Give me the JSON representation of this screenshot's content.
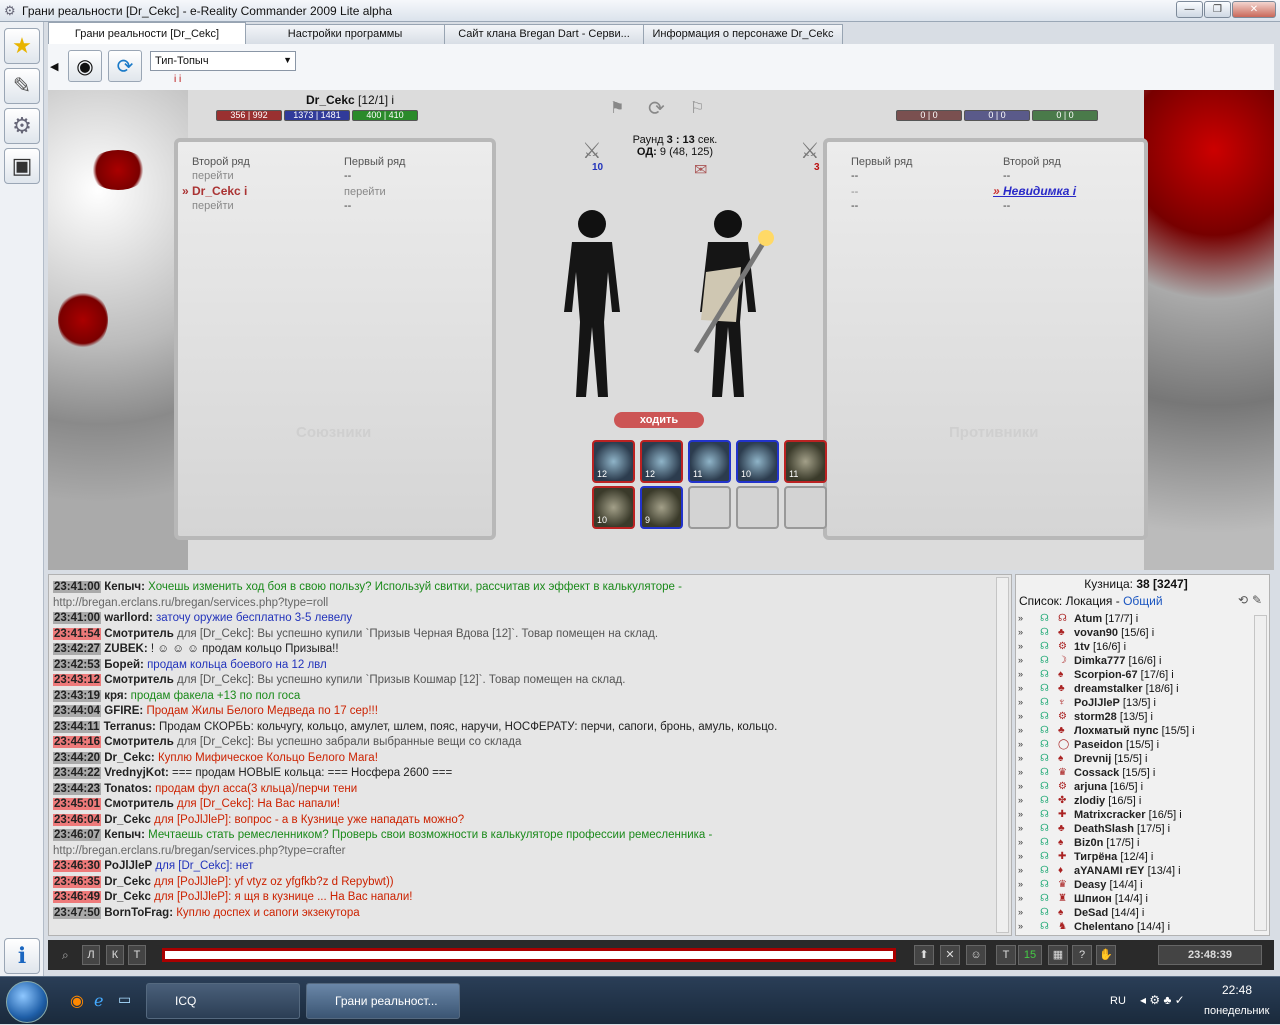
{
  "window": {
    "title": "Грани реальности [Dr_Cekc] - e-Reality Commander 2009 Lite alpha"
  },
  "tabs": [
    {
      "label": "Грани реальности [Dr_Cekc]"
    },
    {
      "label": "Настройки программы"
    },
    {
      "label": "Сайт клана Bregan Dart - Серви..."
    },
    {
      "label": "Информация о персонаже Dr_Cekc"
    }
  ],
  "toolbar": {
    "select_value": "Тип-Топыч",
    "info_marks": "i  i"
  },
  "battle": {
    "player_name": "Dr_Cekc",
    "player_level": "[12/1]",
    "info_mark": "i",
    "hp": "356 | 992",
    "mana": "1373 | 1481",
    "stamina": "400 | 410",
    "enemy_hp": "0 | 0",
    "enemy_mana": "0 | 0",
    "enemy_stamina": "0 | 0",
    "round_label": "Раунд",
    "round_value": "3 : 13",
    "round_unit": "сек.",
    "od_label": "ОД:",
    "od_value": "9 (48, 125)",
    "ally_count": "10",
    "enemy_count": "3",
    "go_button": "ходить",
    "left_panel": {
      "col1": "Второй ряд",
      "col2": "Первый ряд",
      "r1c1": "перейти",
      "r1c2": "--",
      "r2c1": "Dr_Cekc",
      "r2c2": "перейти",
      "r3c1": "перейти",
      "r3c2": "--",
      "footer": "Союзники"
    },
    "right_panel": {
      "col1": "Первый ряд",
      "col2": "Второй ряд",
      "r1c1": "--",
      "r1c2": "--",
      "r2c1": "--",
      "r2c2": "Невидимка",
      "r3c1": "--",
      "r3c2": "--",
      "footer": "Противники"
    },
    "slots": [
      "12",
      "12",
      "11",
      "10",
      "11",
      "10",
      "9"
    ]
  },
  "chat": [
    {
      "time": "23:41:00",
      "nick": "Кепыч:",
      "text": "Хочешь изменить ход боя в свою пользу? Используй свитки, рассчитав их эффект в калькуляторе -",
      "color": "#1a8a1a",
      "hl": false
    },
    {
      "time": "",
      "nick": "",
      "text": "http://bregan.erclans.ru/bregan/services.php?type=roll",
      "color": "#666",
      "hl": false
    },
    {
      "time": "23:41:00",
      "nick": "warllord:",
      "text": "заточу оружие бесплатно 3-5 левелу",
      "color": "#2233bb",
      "hl": false
    },
    {
      "time": "23:41:54",
      "nick": "Смотритель",
      "text": "для [Dr_Cekc]: Вы успешно купили `Призыв Черная Вдова [12]`. Товар помещен на склад.",
      "color": "#555",
      "hl": true
    },
    {
      "time": "23:42:27",
      "nick": "ZUBEK:",
      "text": "!  ☺ ☺ ☺  продам кольцо Призыва!!",
      "color": "#222",
      "hl": false
    },
    {
      "time": "23:42:53",
      "nick": "Борей:",
      "text": "продам кольца боевого на 12 лвл",
      "color": "#2233bb",
      "hl": false
    },
    {
      "time": "23:43:12",
      "nick": "Смотритель",
      "text": "для [Dr_Cekc]: Вы успешно купили `Призыв Кошмар [12]`. Товар помещен на склад.",
      "color": "#555",
      "hl": true
    },
    {
      "time": "23:43:19",
      "nick": "кря:",
      "text": "продам факела +13 по пол госа",
      "color": "#1a8a1a",
      "hl": false
    },
    {
      "time": "23:44:04",
      "nick": "GFIRE:",
      "text": "Продам Жилы Белого Медведа по 17 сер!!!",
      "color": "#cc2200",
      "hl": false
    },
    {
      "time": "23:44:11",
      "nick": "Terranus:",
      "text": "Продам СКОРБЬ: кольчугу, кольцо, амулет, шлем, пояс, наручи, НОСФЕРАТУ: перчи, сапоги, бронь, амуль, кольцо.",
      "color": "#222",
      "hl": false
    },
    {
      "time": "23:44:16",
      "nick": "Смотритель",
      "text": "для [Dr_Cekc]: Вы успешно забрали выбранные вещи со склада",
      "color": "#555",
      "hl": true
    },
    {
      "time": "23:44:20",
      "nick": "Dr_Cekc:",
      "text": "Куплю Мифическое Кольцо Белого Мага!",
      "color": "#cc2200",
      "hl": false
    },
    {
      "time": "23:44:22",
      "nick": "VrednyjKot:",
      "text": "=== продам НОВЫЕ кольца: === Носфера 2600 ===",
      "color": "#222",
      "hl": false
    },
    {
      "time": "23:44:23",
      "nick": "Tonatos:",
      "text": "продам фул асса(3 кльца)/перчи тени",
      "color": "#cc2200",
      "hl": false
    },
    {
      "time": "23:45:01",
      "nick": "Смотритель",
      "text": "для [Dr_Cekc]: На Вас напали!",
      "color": "#cc2200",
      "hl": true
    },
    {
      "time": "23:46:04",
      "nick": "Dr_Cekc",
      "text": "для [PoJlJleP]: вопрос - а в Кузнице уже нападать можно?",
      "color": "#cc2200",
      "hl": true
    },
    {
      "time": "23:46:07",
      "nick": "Кепыч:",
      "text": "Мечтаешь стать ремесленником? Проверь свои возможности в калькуляторе профессии ремесленника -",
      "color": "#1a8a1a",
      "hl": false
    },
    {
      "time": "",
      "nick": "",
      "text": "http://bregan.erclans.ru/bregan/services.php?type=crafter",
      "color": "#666",
      "hl": false
    },
    {
      "time": "23:46:30",
      "nick": "PoJlJleP",
      "text": "для [Dr_Cekc]: нет",
      "color": "#2233bb",
      "hl": true
    },
    {
      "time": "23:46:35",
      "nick": "Dr_Cekc",
      "text": "для [PoJlJleP]: yf vtyz oz yfgfkb?z d Repybwt))",
      "color": "#cc2200",
      "hl": true
    },
    {
      "time": "23:46:49",
      "nick": "Dr_Cekc",
      "text": "для [PoJlJleP]: я щя в кузнице ... На Вас напали!",
      "color": "#cc2200",
      "hl": true
    },
    {
      "time": "23:47:50",
      "nick": "BornToFrag:",
      "text": "Куплю доспех и сапоги экзекутора",
      "color": "#cc2200",
      "hl": false
    }
  ],
  "location": {
    "title": "Кузница:",
    "count": "38",
    "total": "[3247]",
    "list_label": "Список: Локация -",
    "list_mode": "Общий"
  },
  "users": [
    {
      "name": "Atum",
      "lvl": "[17/7]"
    },
    {
      "name": "vovan90",
      "lvl": "[15/6]"
    },
    {
      "name": "1tv",
      "lvl": "[16/6]"
    },
    {
      "name": "Dimka777",
      "lvl": "[16/6]"
    },
    {
      "name": "Scorpion-67",
      "lvl": "[17/6]"
    },
    {
      "name": "dreamstalker",
      "lvl": "[18/6]"
    },
    {
      "name": "PoJlJleP",
      "lvl": "[13/5]"
    },
    {
      "name": "storm28",
      "lvl": "[13/5]"
    },
    {
      "name": "Лохматый пупс",
      "lvl": "[15/5]"
    },
    {
      "name": "Paseidon",
      "lvl": "[15/5]"
    },
    {
      "name": "Drevnij",
      "lvl": "[15/5]"
    },
    {
      "name": "Cossack",
      "lvl": "[15/5]"
    },
    {
      "name": "arjuna",
      "lvl": "[16/5]"
    },
    {
      "name": "zlodiy",
      "lvl": "[16/5]"
    },
    {
      "name": "Matrixcracker",
      "lvl": "[16/5]"
    },
    {
      "name": "DeathSlash",
      "lvl": "[17/5]"
    },
    {
      "name": "Biz0n",
      "lvl": "[17/5]"
    },
    {
      "name": "Тигрёна",
      "lvl": "[12/4]"
    },
    {
      "name": "aYANAMI rEY",
      "lvl": "[13/4]"
    },
    {
      "name": "Deasy",
      "lvl": "[14/4]"
    },
    {
      "name": "Шпион",
      "lvl": "[14/4]"
    },
    {
      "name": "DeSad",
      "lvl": "[14/4]"
    },
    {
      "name": "Chelentano",
      "lvl": "[14/4]"
    }
  ],
  "bottom": {
    "btns": [
      "Л",
      "К",
      "Т"
    ],
    "t_label": "T",
    "t_value": "15",
    "q": "?",
    "clock": "23:48:39"
  },
  "taskbar": {
    "items": [
      "ICQ",
      "Грани реальност..."
    ],
    "lang": "RU",
    "time": "22:48",
    "day": "понедельник"
  }
}
